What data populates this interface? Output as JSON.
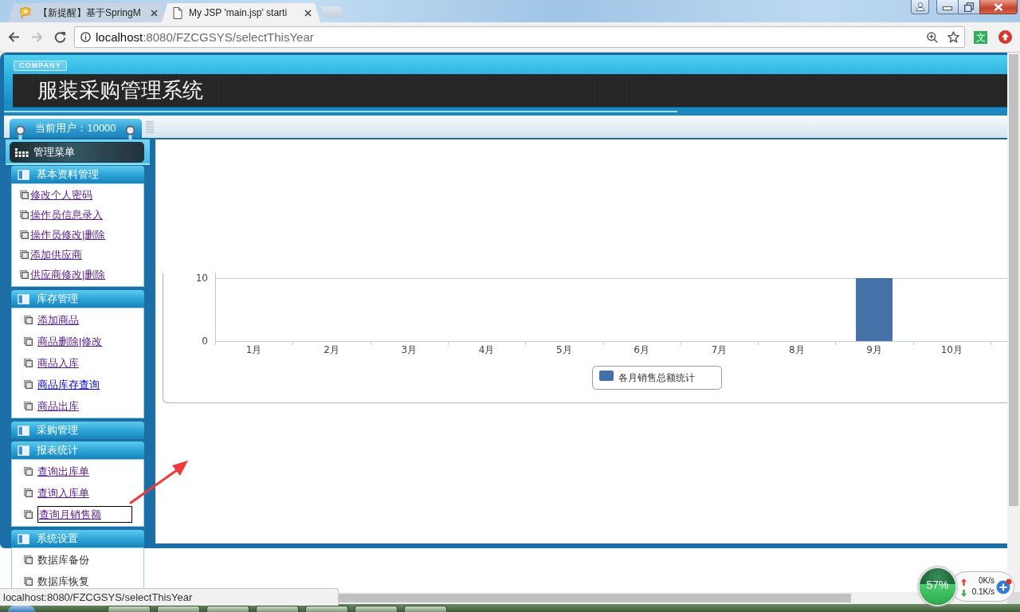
{
  "browser": {
    "tabs": [
      {
        "title": "【新提醒】基于SpringM",
        "selected": false
      },
      {
        "title": "My JSP 'main.jsp' starti",
        "selected": true
      }
    ],
    "nav_buttons": [
      {
        "kind": "back",
        "disabled": false
      },
      {
        "kind": "forward",
        "disabled": true
      },
      {
        "kind": "reload",
        "disabled": false
      }
    ],
    "address": {
      "host": "localhost",
      "path": ":8080/FZCGSYS/selectThisYear"
    },
    "extensions": [
      {
        "kind": "translate",
        "label": "文"
      },
      {
        "kind": "upload"
      }
    ]
  },
  "header": {
    "company": "COMPANY",
    "title": "服装采购管理系统"
  },
  "toolbar": {
    "current_user": "当前用户：10000"
  },
  "sidebar": {
    "title": "管理菜单",
    "sections": [
      {
        "title": "基本资料管理",
        "kind": "compact",
        "expanded": true,
        "items": [
          {
            "label": "修改个人密码",
            "kind": "link",
            "visited": true,
            "focused": false
          },
          {
            "label": "操作员信息录入",
            "kind": "link",
            "visited": true,
            "focused": false
          },
          {
            "label": "操作员修改|删除",
            "kind": "link",
            "visited": true,
            "focused": false
          },
          {
            "label": "添加供应商",
            "kind": "link",
            "visited": true,
            "focused": false
          },
          {
            "label": "供应商修改|删除",
            "kind": "link",
            "visited": true,
            "focused": false
          }
        ]
      },
      {
        "title": "库存管理",
        "kind": "roomy",
        "expanded": true,
        "items": [
          {
            "label": "添加商品",
            "kind": "link",
            "visited": true,
            "focused": false
          },
          {
            "label": "商品删除|修改",
            "kind": "link",
            "visited": true,
            "focused": false
          },
          {
            "label": "商品入库",
            "kind": "link",
            "visited": true,
            "focused": false
          },
          {
            "label": "商品库存查询",
            "kind": "link",
            "visited": false,
            "focused": false
          },
          {
            "label": "商品出库",
            "kind": "link",
            "visited": true,
            "focused": false
          }
        ]
      },
      {
        "title": "采购管理",
        "kind": "roomy",
        "expanded": false
      },
      {
        "title": "报表统计",
        "kind": "roomy",
        "expanded": true,
        "items": [
          {
            "label": "查询出库单",
            "kind": "link",
            "visited": true,
            "focused": false
          },
          {
            "label": "查询入库单",
            "kind": "link",
            "visited": true,
            "focused": false
          },
          {
            "label": "查询月销售额",
            "kind": "link",
            "visited": true,
            "focused": true
          }
        ]
      },
      {
        "title": "系统设置",
        "kind": "roomy",
        "expanded": true,
        "items": [
          {
            "label": "数据库备份",
            "kind": "text"
          },
          {
            "label": "数据库恢复",
            "kind": "text"
          }
        ]
      }
    ]
  },
  "content": {
    "chart_data": {
      "type": "bar",
      "categories": [
        "1月",
        "2月",
        "3月",
        "4月",
        "5月",
        "6月",
        "7月",
        "8月",
        "9月",
        "10月"
      ],
      "ylim": [
        0,
        10
      ],
      "yticks": [
        0,
        10
      ],
      "series": [
        {
          "name": "各月销售总额统计",
          "color": "#4571a8",
          "values": [
            0,
            0,
            0,
            0,
            0,
            0,
            0,
            0,
            10,
            0
          ]
        }
      ]
    }
  },
  "status_bar": {
    "url": "localhost:8080/FZCGSYS/selectThisYear"
  },
  "tray": {
    "memory": {
      "label": "57%",
      "level": 0.57
    },
    "upload_speed": "0K/s",
    "download_speed": "0.1K/s"
  }
}
